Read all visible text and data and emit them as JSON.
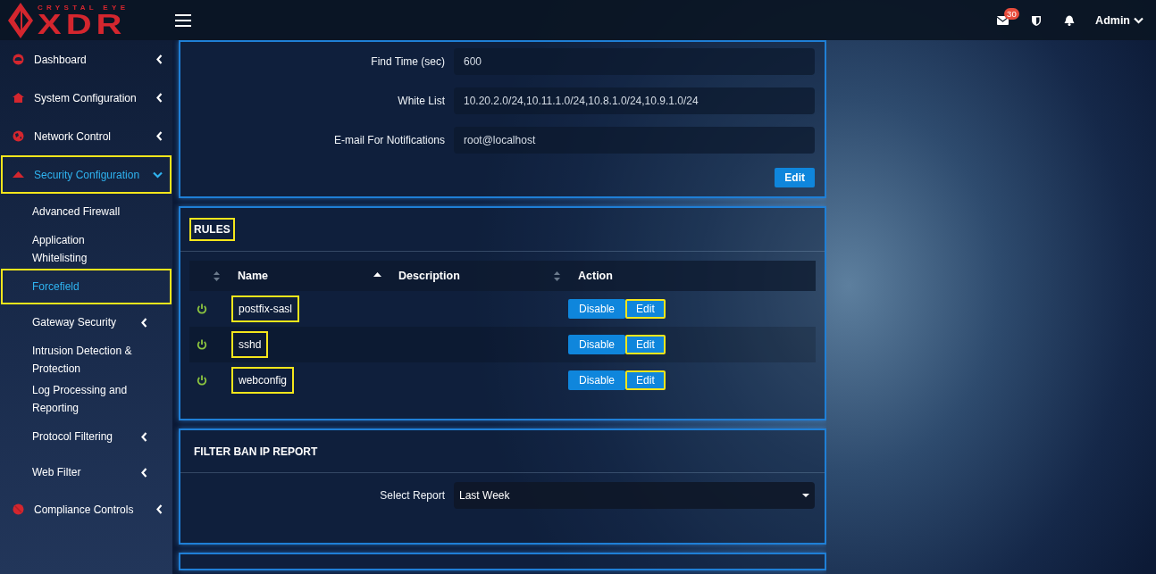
{
  "header": {
    "logo_tagline": "CRYSTAL EYE",
    "logo_name": "XDR",
    "message_count": "30",
    "user_menu": "Admin"
  },
  "sidebar": {
    "items": [
      {
        "label": "Dashboard",
        "kind": "menu",
        "expanded": false,
        "selected": false,
        "highlighted": false
      },
      {
        "label": "System Configuration",
        "kind": "menu",
        "expanded": false,
        "selected": false,
        "highlighted": false
      },
      {
        "label": "Network Control",
        "kind": "menu",
        "expanded": false,
        "selected": false,
        "highlighted": false
      },
      {
        "label": "Security Configuration",
        "kind": "menu",
        "expanded": true,
        "selected": true,
        "highlighted": true,
        "children": [
          {
            "label": "Advanced Firewall",
            "kind": "link",
            "selected": false,
            "highlighted": false
          },
          {
            "label": "Application Whitelisting",
            "kind": "link",
            "selected": false,
            "highlighted": false
          },
          {
            "label": "Forcefield",
            "kind": "link",
            "selected": true,
            "highlighted": true
          },
          {
            "label": "Gateway Security",
            "kind": "menu",
            "expanded": false,
            "selected": false,
            "highlighted": false
          },
          {
            "label": "Intrusion Detection & Protection",
            "kind": "link",
            "selected": false,
            "highlighted": false
          },
          {
            "label": "Log Processing and Reporting",
            "kind": "link",
            "selected": false,
            "highlighted": false
          },
          {
            "label": "Protocol Filtering",
            "kind": "menu",
            "expanded": false,
            "selected": false,
            "highlighted": false
          },
          {
            "label": "Web Filter",
            "kind": "menu",
            "expanded": false,
            "selected": false,
            "highlighted": false
          }
        ]
      },
      {
        "label": "Compliance Controls",
        "kind": "menu",
        "expanded": false,
        "selected": false,
        "highlighted": false
      }
    ]
  },
  "settings": {
    "fields": [
      {
        "label": "Find Time (sec)",
        "value": "600"
      },
      {
        "label": "White List",
        "value": "10.20.2.0/24,10.11.1.0/24,10.8.1.0/24,10.9.1.0/24"
      },
      {
        "label": "E-mail For Notifications",
        "value": "root@localhost"
      }
    ],
    "button": "Edit"
  },
  "rules": {
    "title": "RULES",
    "title_highlighted": true,
    "columns": [
      {
        "sortable": true,
        "sorted_ascending": false
      },
      {
        "label": "Name",
        "sortable": true,
        "sorted_ascending": true
      },
      {
        "label": "Description",
        "sortable": true,
        "sorted_ascending": false
      },
      {
        "label": "Action",
        "sortable": false
      }
    ],
    "rows": [
      {
        "name": "postfix-sasl",
        "enabled": true,
        "highlighted": true,
        "actions": [
          {
            "label": "Disable",
            "highlighted": false
          },
          {
            "label": "Edit",
            "highlighted": true
          }
        ]
      },
      {
        "name": "sshd",
        "enabled": true,
        "highlighted": true,
        "actions": [
          {
            "label": "Disable",
            "highlighted": false
          },
          {
            "label": "Edit",
            "highlighted": true
          }
        ]
      },
      {
        "name": "webconfig",
        "enabled": true,
        "highlighted": true,
        "actions": [
          {
            "label": "Disable",
            "highlighted": false
          },
          {
            "label": "Edit",
            "highlighted": true
          }
        ]
      }
    ]
  },
  "report": {
    "title": "FILTER BAN IP REPORT",
    "label": "Select Report",
    "value": "Last Week"
  }
}
